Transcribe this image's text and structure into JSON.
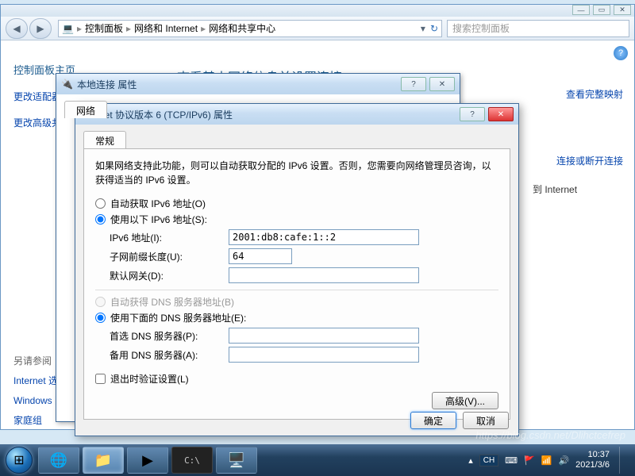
{
  "explorer": {
    "breadcrumb": [
      "控制面板",
      "网络和 Internet",
      "网络和共享中心"
    ],
    "search_placeholder": "搜索控制面板",
    "refresh_icon": "↻"
  },
  "sidebar": {
    "home": "控制面板主页",
    "links": [
      "更改适配器设置",
      "更改高级共享设置"
    ],
    "see_also_title": "另请参阅",
    "see_also": [
      "Internet 选项",
      "Windows 防火墙",
      "家庭组"
    ]
  },
  "main": {
    "title": "查看基本网络信息并设置连接",
    "right_links": [
      "查看完整映射",
      "连接或断开连接"
    ],
    "info_text": "到 Internet"
  },
  "win2": {
    "title": "本地连接 属性",
    "tab": "网络"
  },
  "ipv6": {
    "title": "Internet 协议版本 6 (TCP/IPv6) 属性",
    "tab": "常规",
    "desc": "如果网络支持此功能，则可以自动获取分配的 IPv6 设置。否则，您需要向网络管理员咨询，以获得适当的 IPv6 设置。",
    "radio_auto_ip": "自动获取 IPv6 地址(O)",
    "radio_auto_ip_selected": false,
    "radio_use_ip": "使用以下 IPv6 地址(S):",
    "radio_use_ip_selected": true,
    "ip_label": "IPv6 地址(I):",
    "ip_value": "2001:db8:cafe:1::2",
    "prefix_label": "子网前缀长度(U):",
    "prefix_value": "64",
    "gateway_label": "默认网关(D):",
    "gateway_value": "",
    "radio_auto_dns": "自动获得 DNS 服务器地址(B)",
    "radio_auto_dns_enabled": false,
    "radio_use_dns": "使用下面的 DNS 服务器地址(E):",
    "radio_use_dns_selected": true,
    "dns1_label": "首选 DNS 服务器(P):",
    "dns1_value": "",
    "dns2_label": "备用 DNS 服务器(A):",
    "dns2_value": "",
    "validate_label": "退出时验证设置(L)",
    "validate_checked": false,
    "advanced_btn": "高级(V)...",
    "ok_btn": "确定",
    "cancel_btn": "取消"
  },
  "taskbar": {
    "lang": "CH",
    "time": "10:37",
    "date": "2021/3/6"
  },
  "watermark": "https://blog.csdn.net/Dlihctcefrep"
}
